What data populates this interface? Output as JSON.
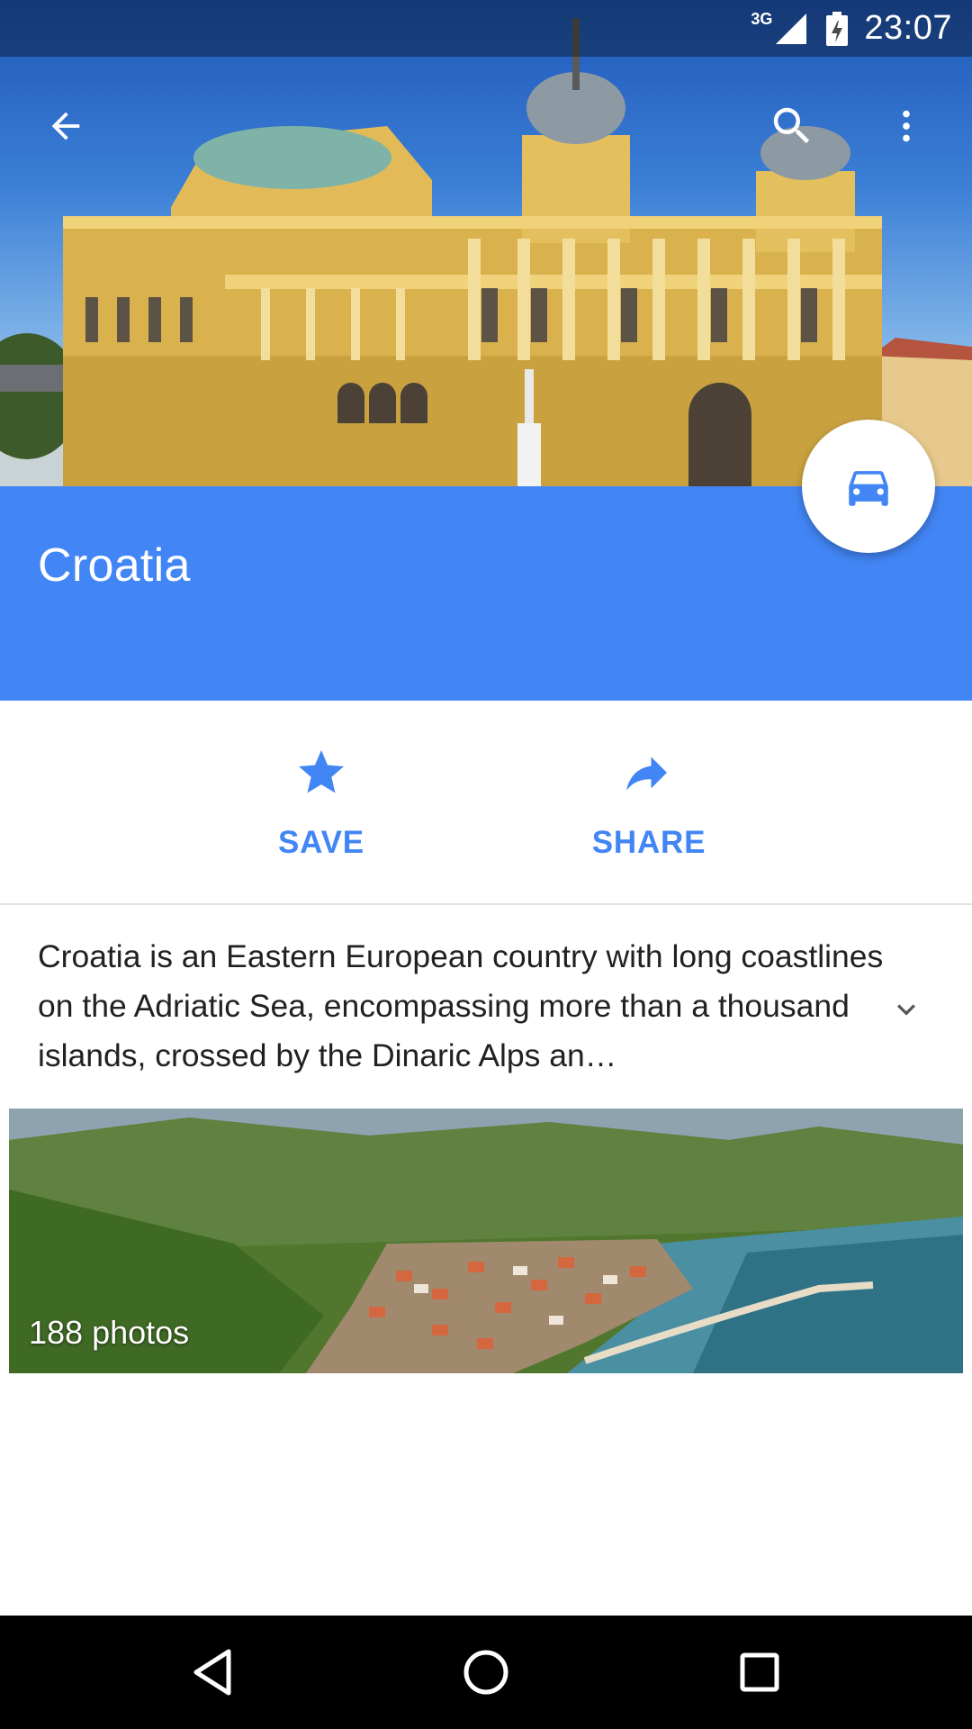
{
  "status_bar": {
    "network": "3G",
    "time": "23:07"
  },
  "app_bar": {
    "back_icon": "arrow-back-icon",
    "search_icon": "search-icon",
    "more_icon": "more-vert-icon"
  },
  "place": {
    "title": "Croatia",
    "description": "Croatia is an Eastern European country with long coastlines on the Adriatic Sea, encompassing more than a thousand islands, crossed by the Dinaric Alps an…"
  },
  "directions_button": {
    "icon": "car-icon"
  },
  "actions": [
    {
      "label": "SAVE",
      "icon": "star-icon"
    },
    {
      "label": "SHARE",
      "icon": "share-arrow-icon"
    }
  ],
  "photos": {
    "count_label": "188 photos"
  },
  "nav_bar": {
    "back_icon": "nav-back-icon",
    "home_icon": "nav-home-icon",
    "recents_icon": "nav-recents-icon"
  },
  "colors": {
    "accent": "#4285f4",
    "text_primary": "#212121",
    "status_bar_overlay": "#000000",
    "nav_bar": "#000000"
  }
}
